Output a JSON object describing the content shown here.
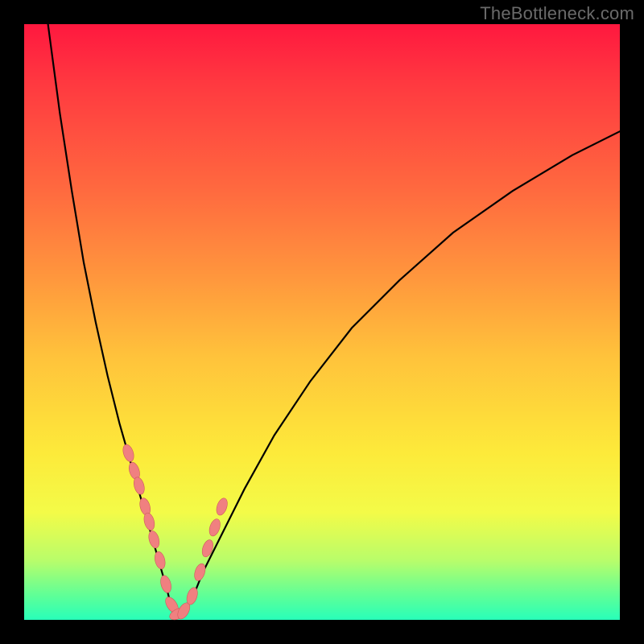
{
  "watermark": "TheBottleneck.com",
  "colors": {
    "frame": "#000000",
    "gradient_top": "#ff183f",
    "gradient_mid1": "#ff953d",
    "gradient_mid2": "#fdea3a",
    "gradient_bottom": "#28ffb9",
    "curve_stroke": "#000000",
    "marker_fill": "#f08080",
    "marker_stroke": "#cd5c5c"
  },
  "chart_data": {
    "type": "line",
    "title": "",
    "xlabel": "",
    "ylabel": "",
    "xlim": [
      0,
      100
    ],
    "ylim": [
      0,
      100
    ],
    "legend": false,
    "grid": false,
    "notes": "V-shaped bottleneck curve over a vertical red→green gradient. Minimum near x≈25. Y expressed as percent height from bottom (0 = bottom, 100 = top). Values estimated from pixel positions.",
    "series": [
      {
        "name": "bottleneck-curve",
        "x": [
          4,
          6,
          8,
          10,
          12,
          14,
          16,
          18,
          20,
          22,
          24,
          25,
          26,
          28,
          30,
          33,
          37,
          42,
          48,
          55,
          63,
          72,
          82,
          92,
          100
        ],
        "y": [
          100,
          85,
          72,
          60,
          50,
          41,
          33,
          26,
          19,
          12,
          5,
          1,
          1,
          3,
          8,
          14,
          22,
          31,
          40,
          49,
          57,
          65,
          72,
          78,
          82
        ]
      }
    ],
    "markers": {
      "name": "highlighted-points",
      "note": "Pink rounded markers clustered along the lower part of the V around the minimum.",
      "x": [
        17.5,
        18.5,
        19.3,
        20.3,
        21.0,
        21.8,
        22.8,
        23.8,
        24.8,
        25.8,
        26.8,
        28.2,
        29.5,
        30.8,
        32.0,
        33.2
      ],
      "y": [
        28.0,
        25.0,
        22.5,
        19.0,
        16.5,
        13.5,
        10.0,
        6.0,
        2.5,
        1.0,
        1.5,
        4.0,
        8.0,
        12.0,
        15.5,
        19.0
      ]
    }
  }
}
